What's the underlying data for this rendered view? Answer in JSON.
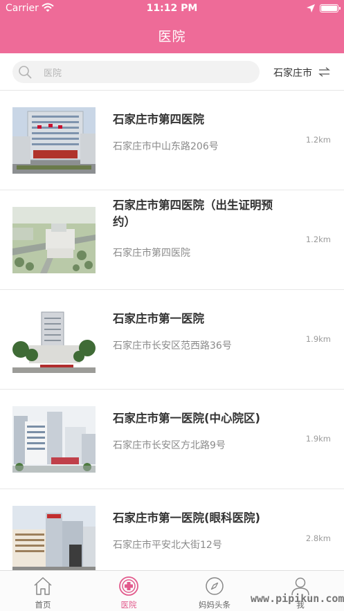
{
  "status_bar": {
    "carrier": "Carrier",
    "time": "11:12 PM"
  },
  "header": {
    "title": "医院"
  },
  "search": {
    "placeholder": "医院",
    "city": "石家庄市"
  },
  "hospitals": [
    {
      "name": "石家庄市第四医院",
      "address": "石家庄市中山东路206号",
      "distance": "1.2km"
    },
    {
      "name": "石家庄市第四医院（出生证明预约）",
      "address": "石家庄市第四医院",
      "distance": "1.2km"
    },
    {
      "name": "石家庄市第一医院",
      "address": "石家庄市长安区范西路36号",
      "distance": "1.9km"
    },
    {
      "name": "石家庄市第一医院(中心院区)",
      "address": "石家庄市长安区方北路9号",
      "distance": "1.9km"
    },
    {
      "name": "石家庄市第一医院(眼科医院)",
      "address": "石家庄市平安北大街12号",
      "distance": "2.8km"
    }
  ],
  "tabbar": {
    "tabs": [
      {
        "label": "首页",
        "icon": "home-icon"
      },
      {
        "label": "医院",
        "icon": "hospital-cross-icon",
        "active": true
      },
      {
        "label": "妈妈头条",
        "icon": "compass-icon"
      },
      {
        "label": "我",
        "icon": "person-icon"
      }
    ]
  },
  "watermark": "www.pipikun.com",
  "colors": {
    "accent": "#ee6b98",
    "tab_active": "#e25a8c"
  }
}
